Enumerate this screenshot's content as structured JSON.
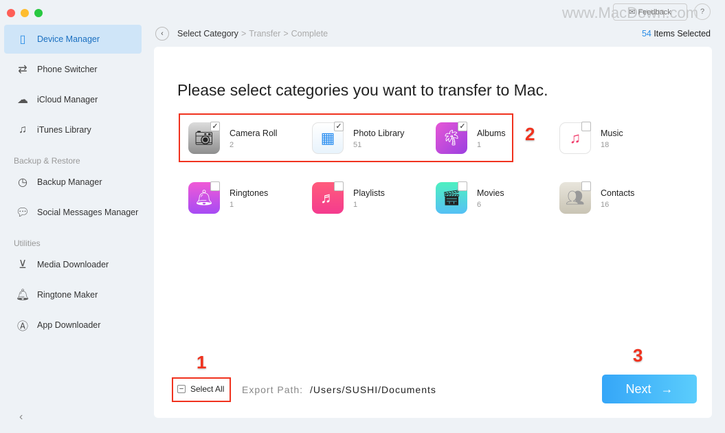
{
  "window": {
    "traffic_colors": [
      "#fe5f57",
      "#febc2e",
      "#28c840"
    ]
  },
  "watermark": "www.MacDown.com",
  "header": {
    "feedback": "Feedback",
    "help": "?"
  },
  "sidebar": {
    "items": [
      {
        "label": "Device Manager",
        "icon": "phone-icon",
        "active": true
      },
      {
        "label": "Phone Switcher",
        "icon": "switch-icon"
      },
      {
        "label": "iCloud Manager",
        "icon": "cloud-icon"
      },
      {
        "label": "iTunes Library",
        "icon": "music-note-icon"
      },
      {
        "label": "Backup Manager",
        "icon": "clock-icon"
      },
      {
        "label": "Social Messages Manager",
        "icon": "chat-icon"
      },
      {
        "label": "Media Downloader",
        "icon": "download-icon"
      },
      {
        "label": "Ringtone Maker",
        "icon": "bell-icon"
      },
      {
        "label": "App Downloader",
        "icon": "app-store-icon"
      }
    ],
    "sections": [
      "Backup & Restore",
      "Utilities"
    ]
  },
  "breadcrumb": [
    "Select Category",
    "Transfer",
    "Complete"
  ],
  "selection": {
    "count": "54",
    "label": " Items Selected"
  },
  "main": {
    "title": "Please select categories you want to transfer to Mac.",
    "categories": [
      {
        "name": "Camera Roll",
        "count": "2",
        "checked": true
      },
      {
        "name": "Photo Library",
        "count": "51",
        "checked": true
      },
      {
        "name": "Albums",
        "count": "1",
        "checked": true
      },
      {
        "name": "Music",
        "count": "18",
        "checked": false
      },
      {
        "name": "Ringtones",
        "count": "1",
        "checked": false
      },
      {
        "name": "Playlists",
        "count": "1",
        "checked": false
      },
      {
        "name": "Movies",
        "count": "6",
        "checked": false
      },
      {
        "name": "Contacts",
        "count": "16",
        "checked": false
      }
    ],
    "select_all": "Select All",
    "export_label": "Export Path:",
    "export_path": "/Users/SUSHI/Documents",
    "next": "Next"
  },
  "annotations": [
    "1",
    "2",
    "3"
  ],
  "colors": {
    "accent": "#2c8ee6",
    "annotation": "#f0321e"
  }
}
